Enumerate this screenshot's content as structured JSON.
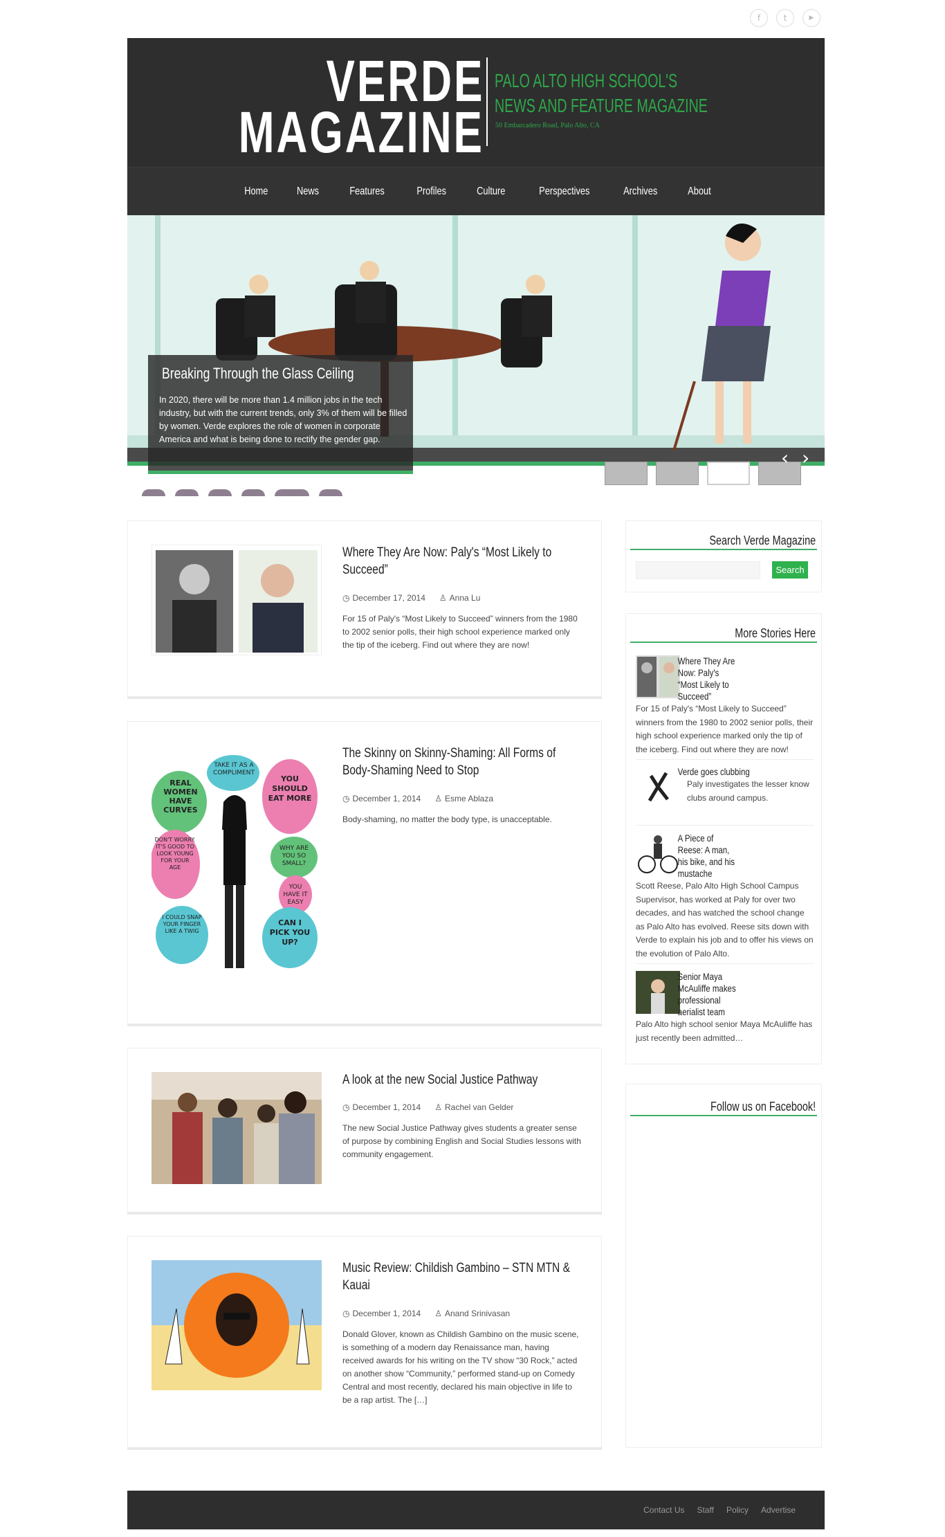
{
  "social": {
    "icons": [
      "facebook-icon",
      "twitter-icon",
      "youtube-icon"
    ],
    "glyphs": [
      "f",
      "t",
      "▶"
    ]
  },
  "header": {
    "logo_line1": "VERDE",
    "logo_line2": "MAGAZINE",
    "tagline1": "PALO ALTO HIGH SCHOOL'S",
    "tagline2": "NEWS AND FEATURE MAGAZINE",
    "address": "50 Embarcadero Road, Palo Alto, CA",
    "nav": [
      "Home",
      "News",
      "Features",
      "Profiles",
      "Culture",
      "Perspectives",
      "Archives",
      "About"
    ]
  },
  "slider": {
    "title": "Breaking Through the Glass Ceiling",
    "text": "In 2020, there will be more than 1.4 million jobs in the tech industry, but with the current trends, only 3% of them will be filled by women. Verde explores the role of women in corporate America and what is being done to rectify the gender gap."
  },
  "posts": [
    {
      "title": "Where They Are Now: Paly's “Most Likely to Succeed”",
      "date": "December 17, 2014",
      "author": "Anna Lu",
      "excerpt": "For 15 of Paly's “Most Likely to Succeed” winners from the 1980 to 2002 senior polls, their high school experience marked only the tip of the iceberg. Find out where they are now!"
    },
    {
      "title": "The Skinny on Skinny-Shaming: All Forms of Body-Shaming Need to Stop",
      "date": "December 1, 2014",
      "author": "Esme Ablaza",
      "excerpt": "Body-shaming, no matter the body type, is unacceptable."
    },
    {
      "title": "A look at the new Social Justice Pathway",
      "date": "December 1, 2014",
      "author": "Rachel van Gelder",
      "excerpt": "The new Social Justice Pathway gives students a greater sense of purpose by combining English and Social Studies lessons with community engagement."
    },
    {
      "title": "Music Review: Childish Gambino – STN MTN & Kauai",
      "date": "December 1, 2014",
      "author": "Anand Srinivasan",
      "excerpt": "Donald Glover, known as Childish Gambino on the music scene, is something of a modern day Renaissance man, having received awards for his writing on the TV show “30 Rock,” acted on another show “Community,” performed stand-up on Comedy Central and most recently, declared his main objective in life to be a rap artist. The […]"
    }
  ],
  "bubbles": {
    "b1": "REAL WOMEN HAVE CURVES",
    "b2": "TAKE IT AS A COMPLIMENT",
    "b3": "YOU SHOULD EAT MORE",
    "b4": "DON'T WORRY. IT'S GOOD TO LOOK YOUNG FOR YOUR AGE",
    "b5": "WHY ARE YOU SO SMALL?",
    "b6": "YOU HAVE IT EASY",
    "b7": "I COULD SNAP YOUR FINGER LIKE A TWIG",
    "b8": "CAN I PICK YOU UP?"
  },
  "sidebar": {
    "search_title": "Search Verde Magazine",
    "search_button": "Search",
    "search_placeholder": "",
    "more_title": "More Stories Here",
    "stories": [
      {
        "title": "Where They Are Now: Paly's “Most Likely to Succeed”",
        "text": "For 15 of Paly's “Most Likely to Succeed” winners from the 1980 to 2002 senior polls, their high school experience marked only the tip of the iceberg. Find out where they are now!"
      },
      {
        "title": "Verde goes clubbing",
        "text": "Paly investigates the lesser know clubs around campus."
      },
      {
        "title": "A Piece of Reese: A man, his bike, and his mustache",
        "text": "Scott Reese, Palo Alto High School Campus Supervisor, has worked at Paly for over two decades, and has watched the school change as Palo Alto has evolved. Reese sits down with Verde to explain his job and to offer his views on the evolution of Palo Alto."
      },
      {
        "title": "Senior Maya McAuliffe makes professional aerialist team",
        "text": "Palo Alto high school senior Maya McAuliffe has just recently been admitted…"
      }
    ],
    "facebook_title": "Follow us on Facebook!"
  },
  "footer": {
    "links": [
      "Contact Us",
      "Staff",
      "Policy",
      "Advertise"
    ]
  },
  "colors": {
    "accent": "#3fae67",
    "header_bg": "#2e2e2e",
    "tagline": "#2ea84a"
  }
}
